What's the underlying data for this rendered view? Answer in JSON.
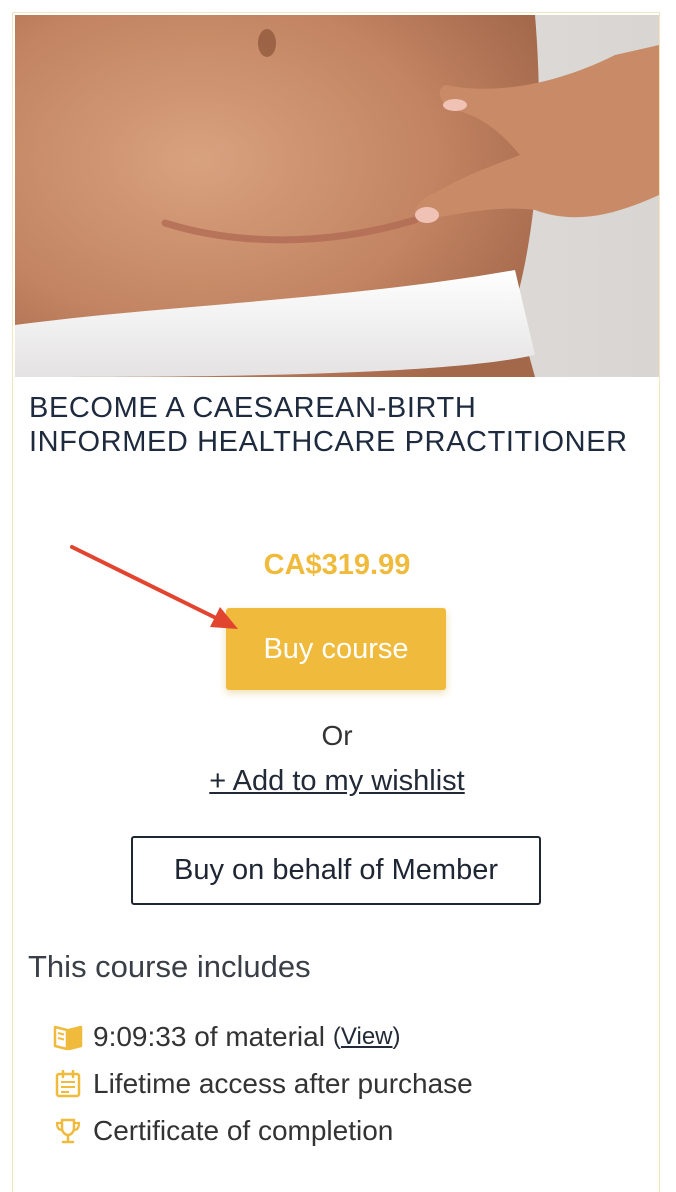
{
  "course": {
    "title": "BECOME A CAESAREAN-BIRTH INFORMED HEALTHCARE PRACTITIONER",
    "price": "CA$319.99",
    "buy_label": "Buy course",
    "or_label": "Or",
    "wishlist_label": "+ Add to my wishlist",
    "behalf_label": "Buy on behalf of Member"
  },
  "includes": {
    "heading": "This course includes",
    "items": [
      {
        "icon": "book-icon",
        "text": "9:09:33 of material",
        "link": "View"
      },
      {
        "icon": "calendar-icon",
        "text": "Lifetime access after purchase"
      },
      {
        "icon": "trophy-icon",
        "text": "Certificate of completion"
      }
    ]
  },
  "colors": {
    "accent": "#f0bb3c",
    "annotation_arrow": "#e2452f",
    "title_text": "#1e2a3e"
  }
}
